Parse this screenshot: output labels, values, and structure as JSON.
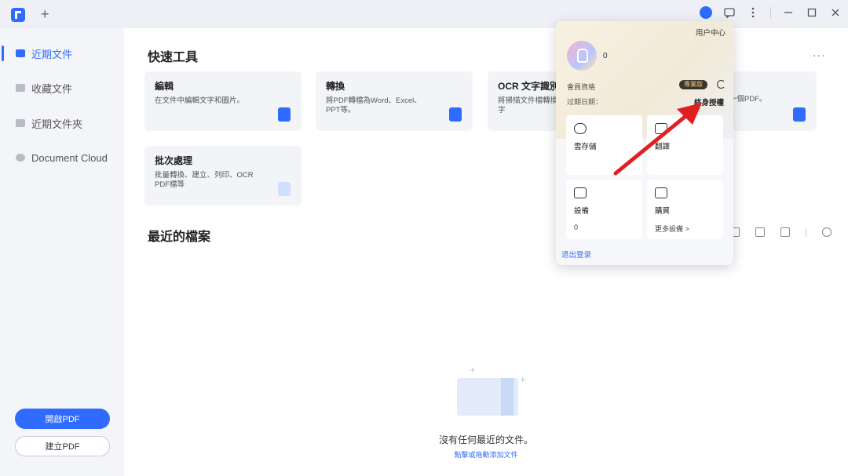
{
  "titlebar": {
    "new_tab": "+"
  },
  "sidebar": {
    "items": [
      {
        "label": "近期文件",
        "active": true
      },
      {
        "label": "收藏文件",
        "active": false
      },
      {
        "label": "近期文件夾",
        "active": false
      },
      {
        "label": "Document Cloud",
        "active": false
      }
    ],
    "open_pdf": "開啟PDF",
    "create_pdf": "建立PDF"
  },
  "main": {
    "quick_tools_title": "快速工具",
    "tools": [
      {
        "title": "編輯",
        "desc": "在文件中編輯文字和圖片。"
      },
      {
        "title": "轉換",
        "desc": "將PDF轉檔為Word、Excel、PPT等。"
      },
      {
        "title": "OCR 文字識別",
        "desc": "將掃描文件檔轉換為可編輯的文字"
      },
      {
        "title": "",
        "desc": "一個PDF。"
      },
      {
        "title": "批次處理",
        "desc": "批量轉換、建立、列印、OCR PDF檔等"
      }
    ],
    "recent_files_title": "最近的檔案",
    "more": "···",
    "empty_text": "沒有任何最近的文件。",
    "empty_link": "點擊或拖動添加文件"
  },
  "popup": {
    "user_center": "用户中心",
    "username": "0",
    "member_label": "會員資格",
    "badge": "專業版",
    "expire_label": "过期日期：",
    "lifetime": "終身授權",
    "tiles": [
      {
        "title": "雲存儲",
        "sub": ""
      },
      {
        "title": "翻譯",
        "sub": ""
      },
      {
        "title": "設備",
        "sub": "0"
      },
      {
        "title": "購買",
        "sub": "更多設備 >"
      }
    ],
    "logout": "退出登录"
  }
}
